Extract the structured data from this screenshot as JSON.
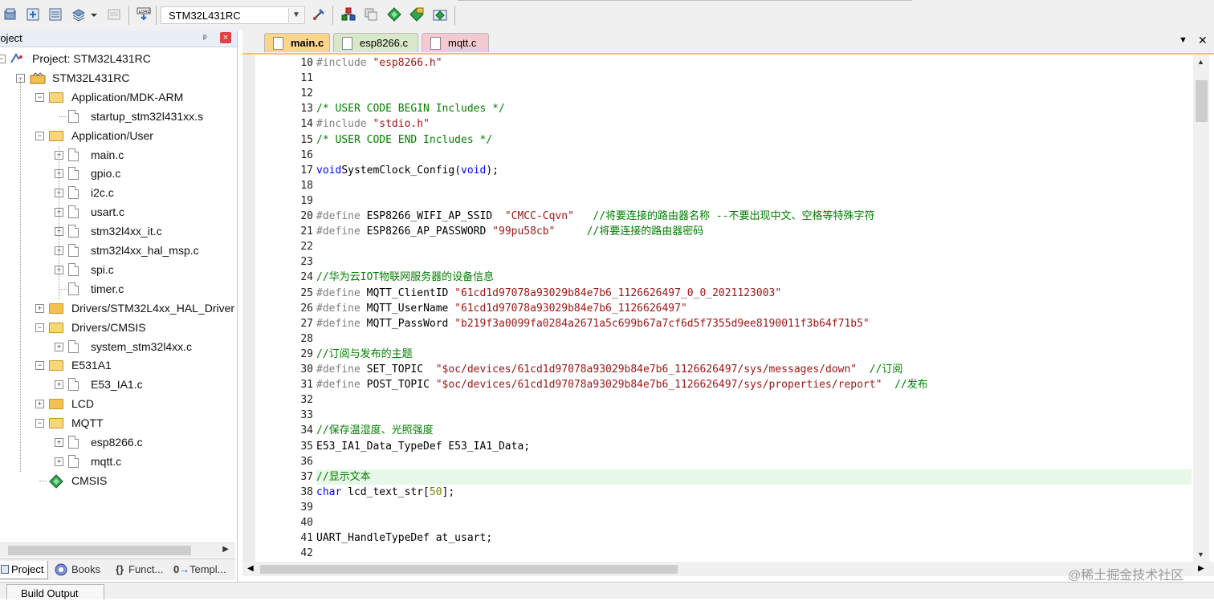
{
  "toolbar": {
    "target_name": "STM32L431RC",
    "load_label": "LOAD",
    "icons": [
      "translate-icon",
      "build-icon",
      "rebuild-icon",
      "batch-build-icon",
      "stop-build-icon",
      "download-load-icon",
      "target-options-icon",
      "manage-components-icon",
      "copy-icon",
      "diamond-green-icon",
      "diamond-pack-icon",
      "install-pack-icon"
    ]
  },
  "project_panel": {
    "title": "roject",
    "pin": "ᵖ",
    "close": "×",
    "tree": [
      {
        "label": "Project: STM32L431RC",
        "level": 0,
        "type": "project",
        "expanded": true
      },
      {
        "label": "STM32L431RC",
        "level": 1,
        "type": "target",
        "expanded": true
      },
      {
        "label": "Application/MDK-ARM",
        "level": 2,
        "type": "folder",
        "expanded": true
      },
      {
        "label": "startup_stm32l431xx.s",
        "level": 3,
        "type": "file",
        "expander": false
      },
      {
        "label": "Application/User",
        "level": 2,
        "type": "folder",
        "expanded": true
      },
      {
        "label": "main.c",
        "level": 3,
        "type": "file",
        "expander": true
      },
      {
        "label": "gpio.c",
        "level": 3,
        "type": "file",
        "expander": true
      },
      {
        "label": "i2c.c",
        "level": 3,
        "type": "file",
        "expander": true
      },
      {
        "label": "usart.c",
        "level": 3,
        "type": "file",
        "expander": true
      },
      {
        "label": "stm32l4xx_it.c",
        "level": 3,
        "type": "file",
        "expander": true
      },
      {
        "label": "stm32l4xx_hal_msp.c",
        "level": 3,
        "type": "file",
        "expander": true
      },
      {
        "label": "spi.c",
        "level": 3,
        "type": "file",
        "expander": true
      },
      {
        "label": "timer.c",
        "level": 3,
        "type": "file",
        "expander": false
      },
      {
        "label": "Drivers/STM32L4xx_HAL_Driver",
        "level": 2,
        "type": "folder",
        "expanded": false
      },
      {
        "label": "Drivers/CMSIS",
        "level": 2,
        "type": "folder",
        "expanded": true
      },
      {
        "label": "system_stm32l4xx.c",
        "level": 3,
        "type": "file",
        "expander": true
      },
      {
        "label": "E531A1",
        "level": 2,
        "type": "folder",
        "expanded": true
      },
      {
        "label": "E53_IA1.c",
        "level": 3,
        "type": "file",
        "expander": true
      },
      {
        "label": "LCD",
        "level": 2,
        "type": "folder",
        "expanded": false
      },
      {
        "label": "MQTT",
        "level": 2,
        "type": "folder",
        "expanded": true
      },
      {
        "label": "esp8266.c",
        "level": 3,
        "type": "file",
        "expander": true
      },
      {
        "label": "mqtt.c",
        "level": 3,
        "type": "file",
        "expander": true
      },
      {
        "label": "CMSIS",
        "level": 2,
        "type": "component",
        "expander": false
      }
    ],
    "tabs": [
      {
        "label": "Project",
        "icon": "project-tab-icon",
        "active": true
      },
      {
        "label": "Books",
        "icon": "books-icon",
        "active": false
      },
      {
        "label": "Funct...",
        "icon": "functions-icon",
        "active": false
      },
      {
        "label": "Templ...",
        "icon": "templates-icon",
        "active": false
      }
    ]
  },
  "editor": {
    "tabs": [
      {
        "label": "main.c",
        "active": true
      },
      {
        "label": "esp8266.c",
        "active": false
      },
      {
        "label": "mqtt.c",
        "active": false
      }
    ],
    "first_line": 10,
    "highlighted_line": 37,
    "lines": [
      [
        [
          "pp",
          "#include "
        ],
        [
          "str",
          "\"esp8266.h\""
        ]
      ],
      [],
      [],
      [
        [
          "cm",
          "/* USER CODE BEGIN Includes */"
        ]
      ],
      [
        [
          "pp",
          "#include "
        ],
        [
          "str",
          "\"stdio.h\""
        ]
      ],
      [
        [
          "cm",
          "/* USER CODE END Includes */"
        ]
      ],
      [],
      [
        [
          "kw",
          "void"
        ],
        [
          "",
          "SystemClock_Config("
        ],
        [
          "kw",
          "void"
        ],
        [
          "",
          ");"
        ]
      ],
      [],
      [],
      [
        [
          "pp",
          "#define "
        ],
        [
          "",
          "ESP8266_WIFI_AP_SSID  "
        ],
        [
          "str",
          "\"CMCC-Cqvn\""
        ],
        [
          "",
          "   "
        ],
        [
          "cm",
          "//将要连接的路由器名称 --不要出现中文、空格等特殊字符"
        ]
      ],
      [
        [
          "pp",
          "#define "
        ],
        [
          "",
          "ESP8266_AP_PASSWORD "
        ],
        [
          "str",
          "\"99pu58cb\""
        ],
        [
          "",
          "     "
        ],
        [
          "cm",
          "//将要连接的路由器密码"
        ]
      ],
      [],
      [],
      [
        [
          "cm",
          "//华为云IOT物联网服务器的设备信息"
        ]
      ],
      [
        [
          "pp",
          "#define "
        ],
        [
          "",
          "MQTT_ClientID "
        ],
        [
          "str",
          "\"61cd1d97078a93029b84e7b6_1126626497_0_0_2021123003\""
        ]
      ],
      [
        [
          "pp",
          "#define "
        ],
        [
          "",
          "MQTT_UserName "
        ],
        [
          "str",
          "\"61cd1d97078a93029b84e7b6_1126626497\""
        ]
      ],
      [
        [
          "pp",
          "#define "
        ],
        [
          "",
          "MQTT_PassWord "
        ],
        [
          "str",
          "\"b219f3a0099fa0284a2671a5c699b67a7cf6d5f7355d9ee8190011f3b64f71b5\""
        ]
      ],
      [],
      [
        [
          "cm",
          "//订阅与发布的主题"
        ]
      ],
      [
        [
          "pp",
          "#define "
        ],
        [
          "",
          "SET_TOPIC  "
        ],
        [
          "str",
          "\"$oc/devices/61cd1d97078a93029b84e7b6_1126626497/sys/messages/down\""
        ],
        [
          "",
          "  "
        ],
        [
          "cm",
          "//订阅"
        ]
      ],
      [
        [
          "pp",
          "#define "
        ],
        [
          "",
          "POST_TOPIC "
        ],
        [
          "str",
          "\"$oc/devices/61cd1d97078a93029b84e7b6_1126626497/sys/properties/report\""
        ],
        [
          "",
          "  "
        ],
        [
          "cm",
          "//发布"
        ]
      ],
      [],
      [],
      [
        [
          "cm",
          "//保存温湿度、光照强度"
        ]
      ],
      [
        [
          "",
          "E53_IA1_Data_TypeDef E53_IA1_Data;"
        ]
      ],
      [],
      [
        [
          "cm",
          "//显示文本"
        ]
      ],
      [
        [
          "kw",
          "char"
        ],
        [
          "",
          " lcd_text_str["
        ],
        [
          "num",
          "50"
        ],
        [
          "",
          "];"
        ]
      ],
      [],
      [],
      [
        [
          "",
          "UART_HandleTypeDef at_usart;"
        ]
      ],
      []
    ]
  },
  "bottom": {
    "build_output_label": "Build Output",
    "watermark": "@稀土掘金技术社区"
  }
}
